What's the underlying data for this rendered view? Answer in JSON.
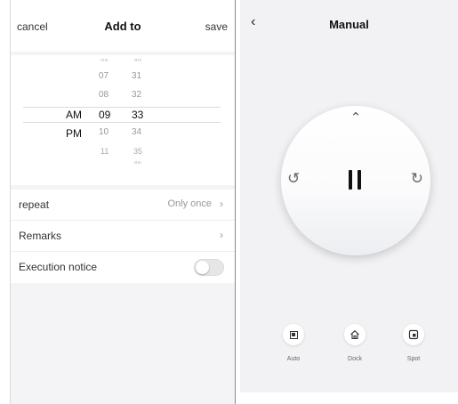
{
  "add_screen": {
    "header": {
      "cancel": "cancel",
      "title": "Add to",
      "save": "save"
    },
    "picker": {
      "ampm": {
        "above": "AM",
        "selected": "PM"
      },
      "hours": [
        "06",
        "07",
        "08",
        "09",
        "10",
        "11"
      ],
      "minutes": [
        "30",
        "31",
        "32",
        "33",
        "34",
        "35",
        "36"
      ],
      "selected_hour": "09",
      "selected_minute": "33"
    },
    "rows": {
      "repeat": {
        "label": "repeat",
        "value": "Only once"
      },
      "remarks": {
        "label": "Remarks"
      },
      "notice": {
        "label": "Execution notice",
        "enabled": false
      }
    }
  },
  "manual_screen": {
    "header": {
      "title": "Manual"
    },
    "modes": [
      {
        "label": "Auto",
        "icon": "square-icon"
      },
      {
        "label": "Dock",
        "icon": "home-icon"
      },
      {
        "label": "Spot",
        "icon": "spot-icon"
      }
    ]
  },
  "colors": {
    "accent_dark": "#111111",
    "toggle_off": "#e6e6e6",
    "panel_bg": "#f2f2f4"
  }
}
